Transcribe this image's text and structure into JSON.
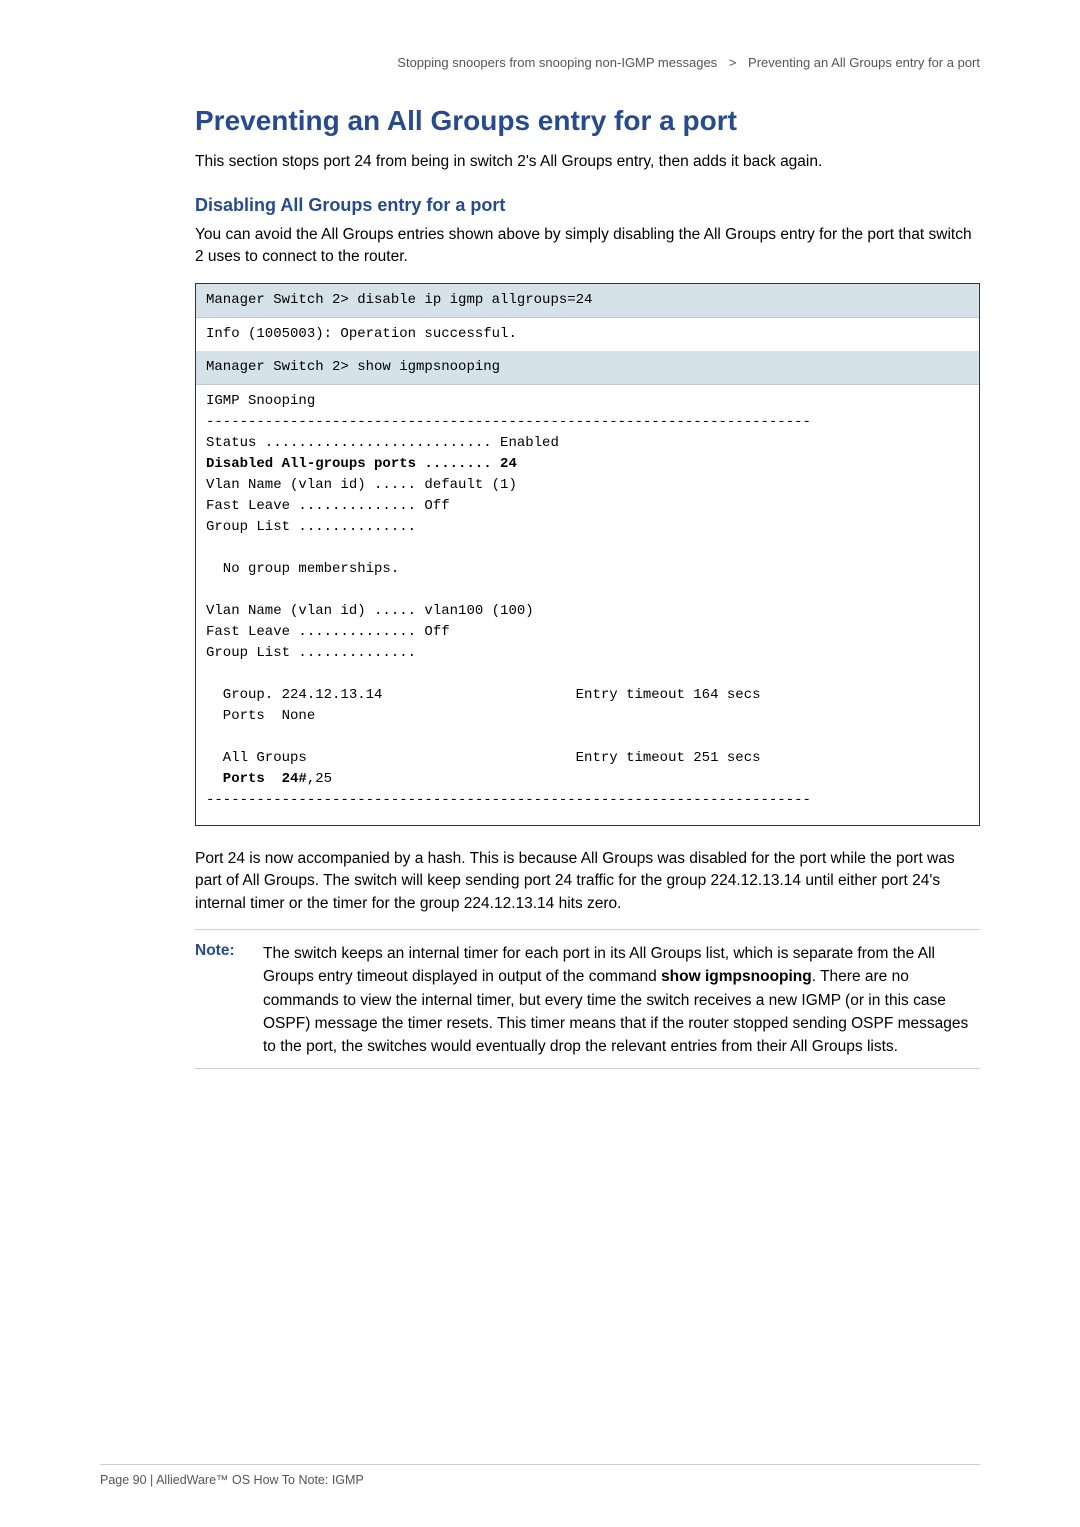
{
  "header": {
    "left": "Stopping snoopers from snooping non-IGMP messages",
    "right": "Preventing an All Groups entry for a port"
  },
  "h1": "Preventing an All Groups entry for a port",
  "intro": "This section stops port 24 from being in switch 2's All Groups entry, then adds it back again.",
  "h2": "Disabling All Groups entry for a port",
  "p_sub": "You can avoid the All Groups entries shown above by simply disabling the All Groups entry for the port that switch 2 uses to connect to the router.",
  "code": {
    "cmd1": "Manager Switch 2> disable ip igmp allgroups=24",
    "out1": "Info (1005003): Operation successful.",
    "cmd2": "Manager Switch 2> show igmpsnooping",
    "block_a": "IGMP Snooping\n------------------------------------------------------------------------\nStatus ........................... Enabled",
    "bold_line1": "Disabled All-groups ports ........ 24",
    "block_b": "\nVlan Name (vlan id) ..... default (1)\nFast Leave .............. Off\nGroup List ..............\n\n  No group memberships.\n\nVlan Name (vlan id) ..... vlan100 (100)\nFast Leave .............. Off\nGroup List ..............\n\n  Group. 224.12.13.14                       Entry timeout 164 secs\n  Ports  None\n\n  All Groups                                Entry timeout 251 secs",
    "bold_ports_prefix": "  Ports  24#",
    "bold_ports_suffix": ",25",
    "block_c": "\n------------------------------------------------------------------------\n"
  },
  "para2": "Port 24 is now accompanied by a hash. This is because All Groups was disabled for the port while the port was part of All Groups. The switch will keep sending port 24 traffic for the group 224.12.13.14 until either port 24's internal timer or the timer for the group 224.12.13.14 hits zero.",
  "note": {
    "label": "Note:",
    "body_a": "The switch keeps an internal timer for each port in its All Groups list, which is separate from the All Groups entry timeout displayed in output of the command ",
    "cmd": "show igmpsnooping",
    "body_b": ". There are no commands to view the internal timer, but every time the switch receives a new IGMP (or in this case OSPF) message the timer resets. This timer means that if the router stopped sending OSPF messages to the port, the switches would eventually drop the relevant entries from their All Groups lists."
  },
  "footer": "Page 90 | AlliedWare™ OS How To Note: IGMP"
}
